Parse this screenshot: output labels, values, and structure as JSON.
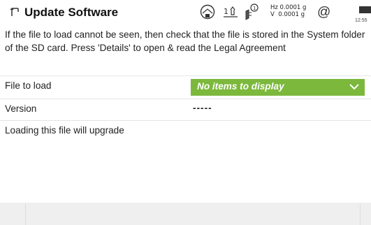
{
  "header": {
    "title": "Update Software",
    "status": {
      "hz_value": "Hz 0.0001 g",
      "v_value": "V  0.0001 g",
      "satellite_count": "1",
      "battery_time": "12:55",
      "at_symbol": "@"
    }
  },
  "info_text": "If the file to load cannot be seen, then check that the file is stored in the System folder of the SD card. Press 'Details' to open & read the Legal Agreement",
  "fields": {
    "file_to_load": {
      "label": "File to load",
      "value": "No items to display"
    },
    "version": {
      "label": "Version",
      "value": "-----"
    },
    "upgrade": {
      "label": "Loading this file will upgrade"
    }
  },
  "colors": {
    "dropdown_bg": "#7bb83c",
    "bottom_bar": "#efefef"
  }
}
